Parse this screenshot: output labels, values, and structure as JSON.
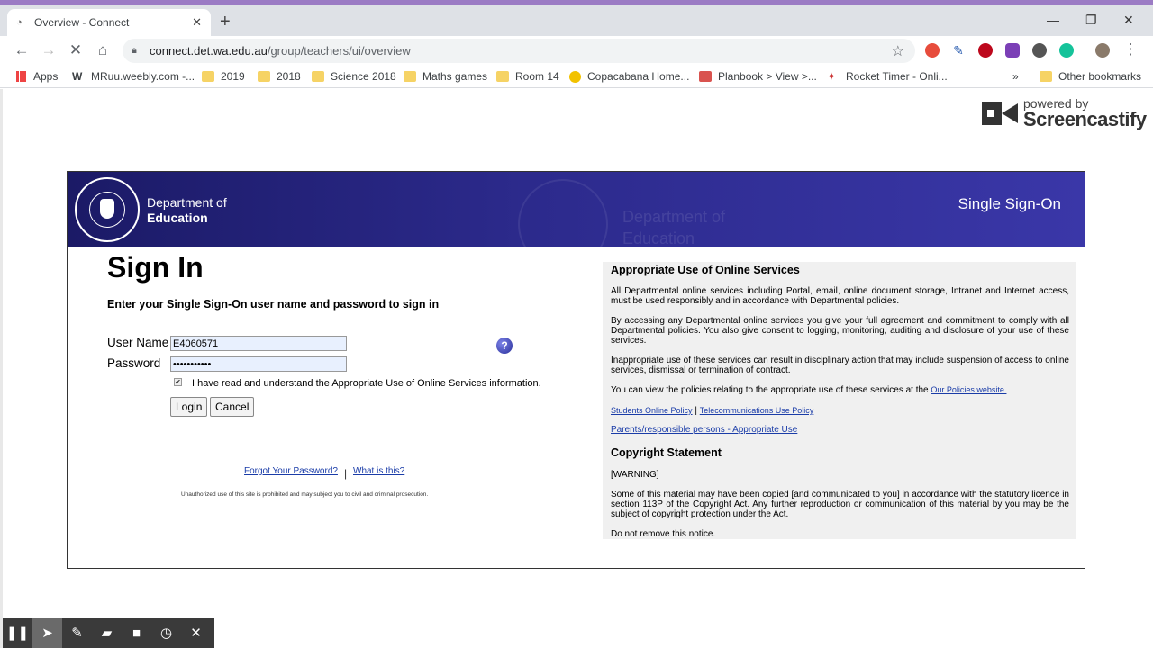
{
  "browser": {
    "tab_title": "Overview - Connect",
    "url_host": "connect.det.wa.edu.au",
    "url_path": "/group/teachers/ui/overview"
  },
  "bookmarks": [
    {
      "label": "Apps",
      "icon": "apps-grid-icon"
    },
    {
      "label": "MRuu.weebly.com -...",
      "icon": "weebly-icon"
    },
    {
      "label": "2019",
      "icon": "folder-icon"
    },
    {
      "label": "2018",
      "icon": "folder-icon"
    },
    {
      "label": "Science 2018",
      "icon": "folder-icon"
    },
    {
      "label": "Maths games",
      "icon": "folder-icon"
    },
    {
      "label": "Room 14",
      "icon": "folder-icon"
    },
    {
      "label": "Copacabana Home...",
      "icon": "site-icon"
    },
    {
      "label": "Planbook > View >...",
      "icon": "site-icon"
    },
    {
      "label": "Rocket Timer - Onli...",
      "icon": "rocket-icon"
    },
    {
      "label": "Other bookmarks",
      "icon": "folder-icon"
    }
  ],
  "screencastify": {
    "powered": "powered by",
    "name": "Screencastify"
  },
  "banner": {
    "dept_line1": "Department of",
    "dept_line2": "Education",
    "right_title": "Single Sign-On"
  },
  "signin": {
    "heading": "Sign In",
    "subheading": "Enter your Single Sign-On user name and password to sign in",
    "username_label": "User Name",
    "username_value": "E4060571",
    "password_label": "Password",
    "password_value": "•••••••••••",
    "checkbox_label": "I have read and understand the Appropriate Use of Online Services information.",
    "checkbox_checked": true,
    "login_label": "Login",
    "cancel_label": "Cancel",
    "forgot_link": "Forgot Your Password?",
    "separator": "|",
    "whatis_link": "What is this?",
    "unauthorized": "Unauthorized use of this site is prohibited and may subject you to civil and criminal prosecution."
  },
  "policy": {
    "heading": "Appropriate Use of Online Services",
    "p1": "All Departmental online services including Portal, email, online document storage, Intranet and Internet access, must be used responsibly and in accordance with Departmental policies.",
    "p2": "By accessing any Departmental online services you give your full agreement and commitment to comply with all Departmental policies. You also give consent to logging, monitoring, auditing and disclosure of your use of these services.",
    "p3": "Inappropriate use of these services can result in disciplinary action that may include suspension of access to online services, dismissal or termination of contract.",
    "p4_text": "You can view the policies relating to the appropriate use of these services at the",
    "p4_link": "Our Policies website.",
    "link_students": "Students Online Policy",
    "link_sep": "|",
    "link_telecom": "Telecommunications Use Policy",
    "link_parents": "Parents/responsible persons - Appropriate Use",
    "copyright_heading": "Copyright Statement",
    "warning": "[WARNING]",
    "copyright_text": "Some of this material may have been copied [and communicated to you] in accordance with the statutory licence in section 113P of the Copyright Act. Any further reproduction or communication of this material by you may be the subject of copyright protection under the Act.",
    "do_not_remove": "Do not remove this notice."
  }
}
